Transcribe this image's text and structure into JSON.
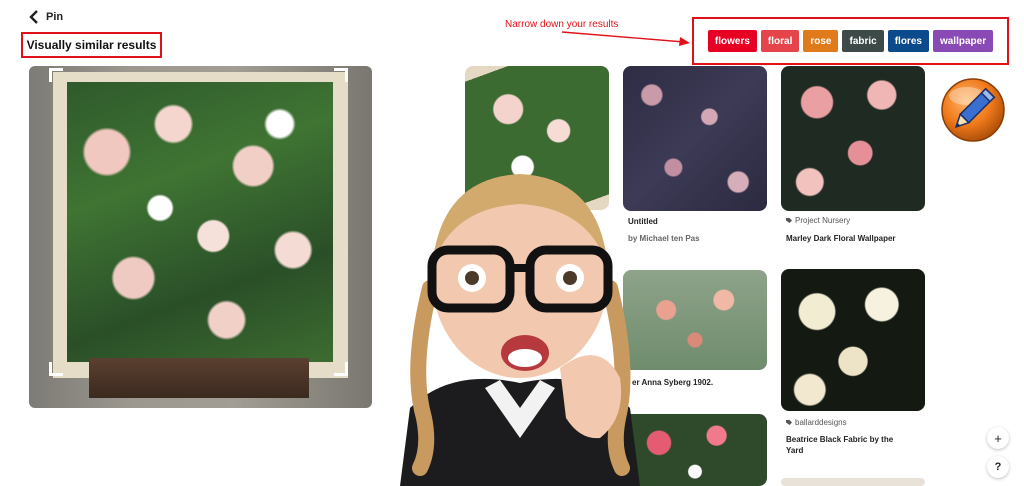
{
  "nav": {
    "back_label": "Pin"
  },
  "page_title": "Visually similar results",
  "annotation": {
    "text": "Narrow down your results"
  },
  "filters": [
    {
      "label": "flowers",
      "color": "#e60023"
    },
    {
      "label": "floral",
      "color": "#e5454a"
    },
    {
      "label": "rose",
      "color": "#e07b1b"
    },
    {
      "label": "fabric",
      "color": "#3d4a47"
    },
    {
      "label": "flores",
      "color": "#0b4a8b"
    },
    {
      "label": "wallpaper",
      "color": "#8a4ab6"
    }
  ],
  "results": [
    {
      "title": "Untitled",
      "subtitle": "by Michael ten Pas"
    },
    {
      "source": "Project Nursery",
      "title": "Marley Dark Floral Wallpaper"
    },
    {
      "title": "er Anna Syberg 1902."
    },
    {
      "source": "ballarddesigns",
      "title_line1": "Beatrice Black Fabric by the",
      "title_line2": "Yard"
    }
  ],
  "controls": {
    "zoom_in_icon": "+",
    "help_icon": "?"
  },
  "colors": {
    "highlight": "#e1111a"
  }
}
